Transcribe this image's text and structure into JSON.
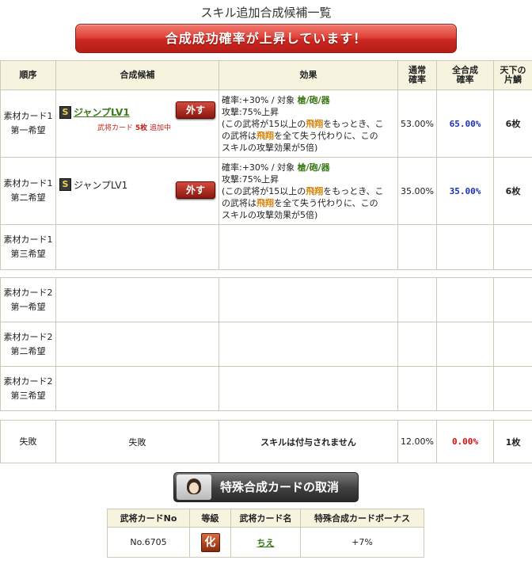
{
  "page_title": "スキル追加合成候補一覧",
  "banner": "合成成功確率が上昇しています！",
  "headers": {
    "order": "順序",
    "candidate": "合成候補",
    "effect": "効果",
    "normal_rate_1": "通常",
    "normal_rate_2": "確率",
    "total_rate_1": "全合成",
    "total_rate_2": "確率",
    "tenka_1": "天下の",
    "tenka_2": "片鱗"
  },
  "rows": [
    {
      "order_1": "素材カード1",
      "order_2": "第一希望",
      "skill_badge": "S",
      "skill_name": "ジャンプLV1",
      "remove_label": "外す",
      "note_prefix": "武将カード",
      "note_count": "5枚",
      "note_suffix": "追加中",
      "effect_line1_prefix": "確率:+30% / 対象",
      "effect_target": "槍/砲/器",
      "effect_line2": "攻撃:75%上昇",
      "effect_line3_a": "(この武将が15以上の",
      "effect_line3_hl": "飛翔",
      "effect_line3_b": "をもっとき、こ",
      "effect_line4_a": "の武将は",
      "effect_line4_hl": "飛翔",
      "effect_line4_b": "を全て失う代わりに、この",
      "effect_line5": "スキルの攻撃効果が5倍)",
      "normal_rate": "53.00%",
      "total_rate": "65.00%",
      "tenka": "6枚"
    },
    {
      "order_1": "素材カード1",
      "order_2": "第二希望",
      "skill_badge": "S",
      "skill_name": "ジャンプLV1",
      "remove_label": "外す",
      "effect_line1_prefix": "確率:+30% / 対象",
      "effect_target": "槍/砲/器",
      "effect_line2": "攻撃:75%上昇",
      "effect_line3_a": "(この武将が15以上の",
      "effect_line3_hl": "飛翔",
      "effect_line3_b": "をもっとき、こ",
      "effect_line4_a": "の武将は",
      "effect_line4_hl": "飛翔",
      "effect_line4_b": "を全て失う代わりに、この",
      "effect_line5": "スキルの攻撃効果が5倍)",
      "normal_rate": "35.00%",
      "total_rate": "35.00%",
      "tenka": "6枚"
    },
    {
      "order_1": "素材カード1",
      "order_2": "第三希望"
    },
    {
      "order_1": "素材カード2",
      "order_2": "第一希望"
    },
    {
      "order_1": "素材カード2",
      "order_2": "第二希望"
    },
    {
      "order_1": "素材カード2",
      "order_2": "第三希望"
    }
  ],
  "fail_row": {
    "order": "失敗",
    "candidate": "失敗",
    "effect": "スキルは付与されません",
    "normal_rate": "12.00%",
    "total_rate": "0.00%",
    "tenka": "1枚"
  },
  "cancel_button": "特殊合成カードの取消",
  "card_table": {
    "headers": [
      "武将カードNo",
      "等級",
      "武将カード名",
      "特殊合成カードボーナス"
    ],
    "card_no": "No.6705",
    "rank": "化",
    "card_name": "ちえ",
    "bonus": "+7%"
  },
  "colors": {
    "banner": "#d63a30",
    "total_rate_blue": "#1a2fb5",
    "total_rate_red": "#d10f0f",
    "target_green": "#3a7a1a",
    "highlight_orange": "#d6860f"
  }
}
